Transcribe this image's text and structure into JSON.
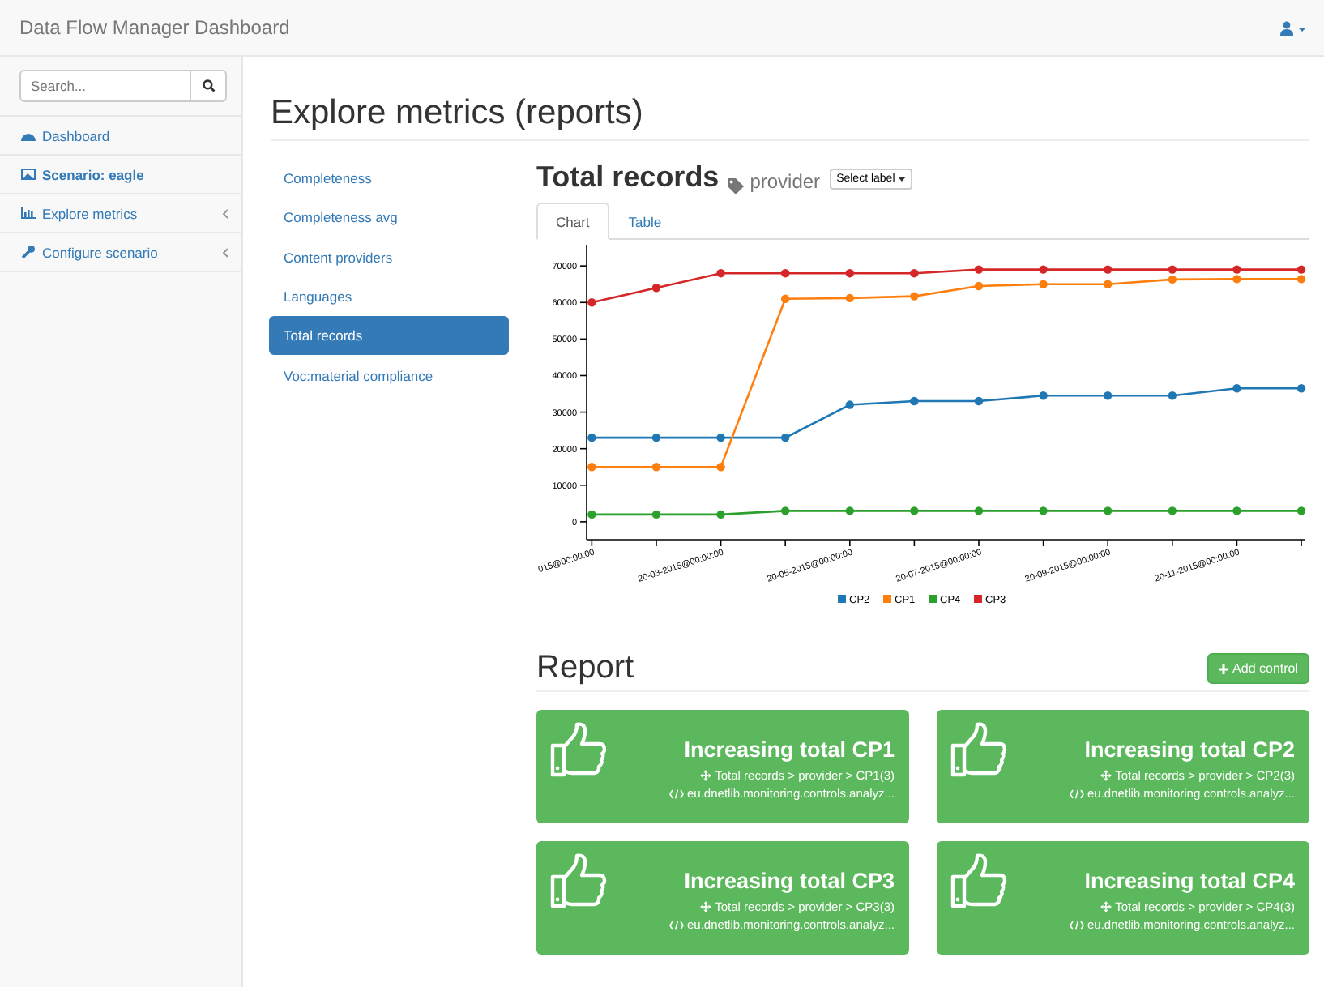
{
  "navbar": {
    "brand": "Data Flow Manager Dashboard"
  },
  "sidebar": {
    "search": {
      "placeholder": "Search..."
    },
    "items": [
      {
        "label": "Dashboard",
        "selected": false,
        "collapsible": false
      },
      {
        "label": "Scenario: eagle",
        "selected": true,
        "collapsible": false
      },
      {
        "label": "Explore metrics",
        "selected": false,
        "collapsible": true
      },
      {
        "label": "Configure scenario",
        "selected": false,
        "collapsible": true
      }
    ]
  },
  "page": {
    "title": "Explore metrics (reports)"
  },
  "metrics_nav": [
    {
      "label": "Completeness",
      "selected": false
    },
    {
      "label": "Completeness avg",
      "selected": false
    },
    {
      "label": "Content providers",
      "selected": false
    },
    {
      "label": "Languages",
      "selected": false
    },
    {
      "label": "Total records",
      "selected": true
    },
    {
      "label": "Voc:material compliance",
      "selected": false
    }
  ],
  "metric": {
    "title": "Total records",
    "tag": "provider",
    "label_dropdown": "Select label",
    "tabs": [
      {
        "label": "Chart",
        "selected": true
      },
      {
        "label": "Table",
        "selected": false
      }
    ],
    "chart_data": {
      "type": "line",
      "legend": "bottom",
      "categories": [
        "015@00:00:00",
        null,
        "20-03-2015@00:00:00",
        null,
        "20-05-2015@00:00:00",
        null,
        "20-07-2015@00:00:00",
        null,
        "20-09-2015@00:00:00",
        null,
        "20-11-2015@00:00:00",
        null
      ],
      "yticks": [
        0,
        10000,
        20000,
        30000,
        40000,
        50000,
        60000,
        70000
      ],
      "ylim": [
        -4900,
        75800
      ],
      "series": [
        {
          "name": "CP2",
          "color": "#1f77b4",
          "marker": "circle",
          "values": [
            23000,
            23000,
            23000,
            23000,
            32000,
            33000,
            33000,
            34500,
            34500,
            34500,
            36500,
            36500
          ]
        },
        {
          "name": "CP1",
          "color": "#ff7f0e",
          "marker": "circle",
          "values": [
            15000,
            15000,
            15000,
            61000,
            61200,
            61700,
            64500,
            65000,
            65000,
            66300,
            66400,
            66400
          ]
        },
        {
          "name": "CP4",
          "color": "#2ca02c",
          "marker": "circle",
          "values": [
            2000,
            2000,
            2000,
            3000,
            3000,
            3000,
            3000,
            3000,
            3000,
            3000,
            3000,
            3000
          ]
        },
        {
          "name": "CP3",
          "color": "#d62728",
          "marker": "circle",
          "values": [
            60000,
            64000,
            68000,
            68000,
            68000,
            68000,
            69000,
            69000,
            69000,
            69000,
            69000,
            69000
          ]
        }
      ]
    }
  },
  "report": {
    "title": "Report",
    "add_button": "Add control",
    "controls": [
      {
        "title": "Increasing total CP1",
        "path": "Total records > provider > CP1(3)",
        "class": "eu.dnetlib.monitoring.controls.analyz..."
      },
      {
        "title": "Increasing total CP2",
        "path": "Total records > provider > CP2(3)",
        "class": "eu.dnetlib.monitoring.controls.analyz..."
      },
      {
        "title": "Increasing total CP3",
        "path": "Total records > provider > CP3(3)",
        "class": "eu.dnetlib.monitoring.controls.analyz..."
      },
      {
        "title": "Increasing total CP4",
        "path": "Total records > provider > CP4(3)",
        "class": "eu.dnetlib.monitoring.controls.analyz..."
      }
    ]
  }
}
